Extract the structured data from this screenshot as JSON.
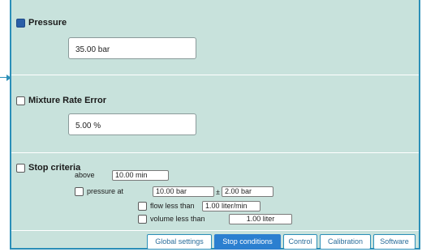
{
  "pressure": {
    "title": "Pressure",
    "checked": true,
    "value": "35.00 bar"
  },
  "mixture": {
    "title": "Mixture Rate Error",
    "checked": false,
    "value": "5.00 %"
  },
  "stop": {
    "title": "Stop criteria",
    "above_label": "above",
    "above_value": "10.00 min",
    "pressure_at_label": "pressure at",
    "pressure_at_value": "10.00 bar",
    "pm_symbol": "±",
    "tolerance_value": "2.00 bar",
    "flow_label": "flow less than",
    "flow_value": "1.00 liter/min",
    "volume_label": "volume less than",
    "volume_value": "1.00 liter"
  },
  "tabs": [
    {
      "label": "Global settings",
      "active": false
    },
    {
      "label": "Stop conditions",
      "active": true
    },
    {
      "label": "Control",
      "active": false
    },
    {
      "label": "Calibration",
      "active": false
    },
    {
      "label": "Software",
      "active": false
    }
  ],
  "colors": {
    "panel_bg": "#c8e2dc",
    "border": "#2b8fb8",
    "active_tab": "#2b7fd0",
    "checked_box": "#2a5fa8"
  }
}
